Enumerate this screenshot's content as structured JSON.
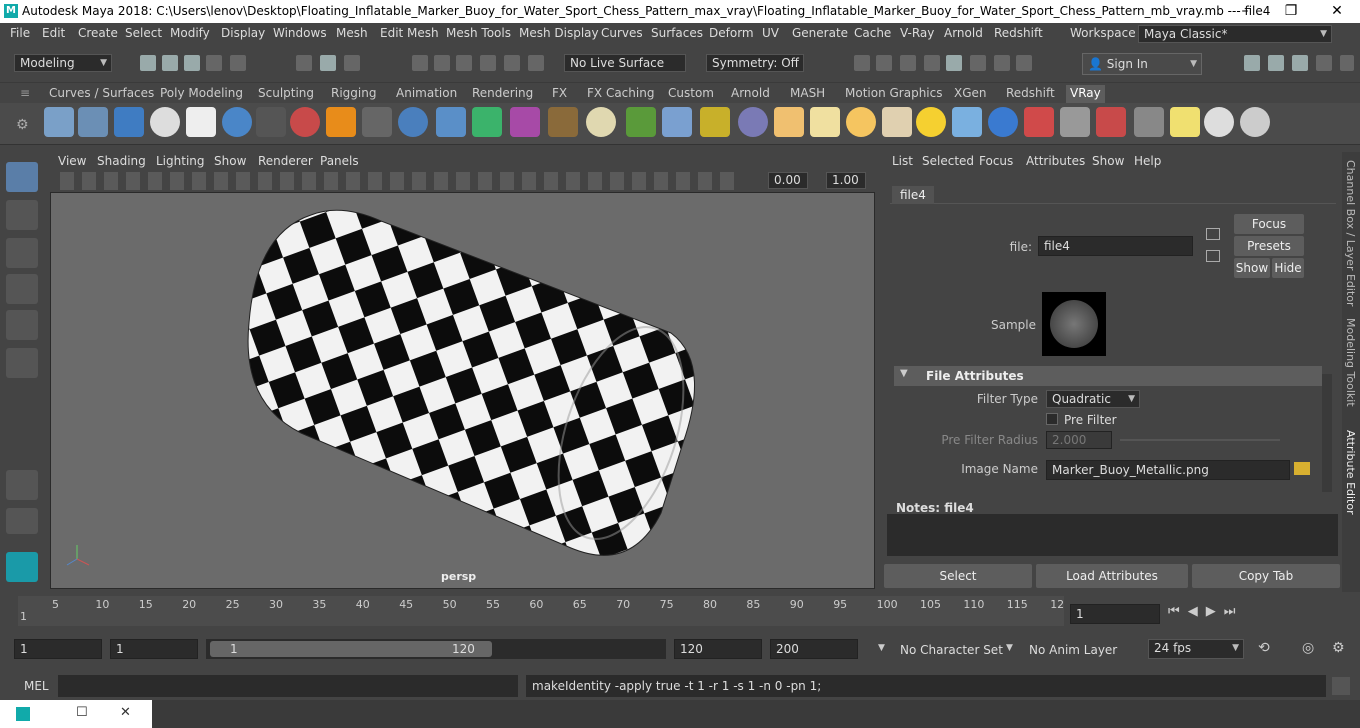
{
  "window": {
    "title": "Autodesk Maya 2018: C:\\Users\\lenov\\Desktop\\Floating_Inflatable_Marker_Buoy_for_Water_Sport_Chess_Pattern_max_vray\\Floating_Inflatable_Marker_Buoy_for_Water_Sport_Chess_Pattern_mb_vray.mb  ---  file4",
    "minimize": "–",
    "maximize": "❐",
    "close": "✕"
  },
  "menu": [
    "File",
    "Edit",
    "Create",
    "Select",
    "Modify",
    "Display",
    "Windows",
    "Mesh",
    "Edit Mesh",
    "Mesh Tools",
    "Mesh Display",
    "Curves",
    "Surfaces",
    "Deform",
    "UV",
    "Generate",
    "Cache",
    "V-Ray",
    "Arnold",
    "Redshift"
  ],
  "workspace": {
    "label": "Workspace :",
    "value": "Maya Classic*"
  },
  "status": {
    "mode": "Modeling",
    "live_surface": "No Live Surface",
    "symmetry": "Symmetry: Off",
    "sign_in": "Sign In"
  },
  "shelf_tabs": [
    "Curves / Surfaces",
    "Poly Modeling",
    "Sculpting",
    "Rigging",
    "Animation",
    "Rendering",
    "FX",
    "FX Caching",
    "Custom",
    "Arnold",
    "MASH",
    "Motion Graphics",
    "XGen",
    "Redshift",
    "VRay"
  ],
  "shelf_active": "VRay",
  "viewport": {
    "menu": [
      "View",
      "Shading",
      "Lighting",
      "Show",
      "Renderer",
      "Panels"
    ],
    "val1": "0.00",
    "val2": "1.00",
    "camera": "persp"
  },
  "attr": {
    "menu": [
      "List",
      "Selected",
      "Focus",
      "Attributes",
      "Show",
      "Help"
    ],
    "tab": "file4",
    "file_label": "file:",
    "file_value": "file4",
    "focus": "Focus",
    "presets": "Presets",
    "show": "Show",
    "hide": "Hide",
    "sample": "Sample",
    "section": "File Attributes",
    "filter_type_label": "Filter Type",
    "filter_type_value": "Quadratic",
    "pre_filter": "Pre Filter",
    "pre_filter_radius_label": "Pre Filter Radius",
    "pre_filter_radius_value": "2.000",
    "image_name_label": "Image Name",
    "image_name_value": "Marker_Buoy_Metallic.png",
    "notes": "Notes:  file4",
    "select": "Select",
    "load": "Load Attributes",
    "copy": "Copy Tab"
  },
  "side_tabs": [
    "Channel Box / Layer Editor",
    "Modeling Toolkit",
    "Attribute Editor"
  ],
  "timeline": {
    "ticks": [
      "5",
      "10",
      "15",
      "20",
      "25",
      "30",
      "35",
      "40",
      "45",
      "50",
      "55",
      "60",
      "65",
      "70",
      "75",
      "80",
      "85",
      "90",
      "95",
      "100",
      "105",
      "110",
      "115",
      "12"
    ],
    "start_tick": "1",
    "current": "1"
  },
  "range": {
    "start": "1",
    "start2": "1",
    "slider_start": "1",
    "slider_end": "120",
    "end": "120",
    "end2": "200",
    "char_set": "No Character Set",
    "anim_layer": "No Anim Layer",
    "fps": "24 fps"
  },
  "cmd": {
    "label": "MEL",
    "result": "makeIdentity -apply true -t 1 -r 1 -s 1 -n 0 -pn 1;"
  }
}
